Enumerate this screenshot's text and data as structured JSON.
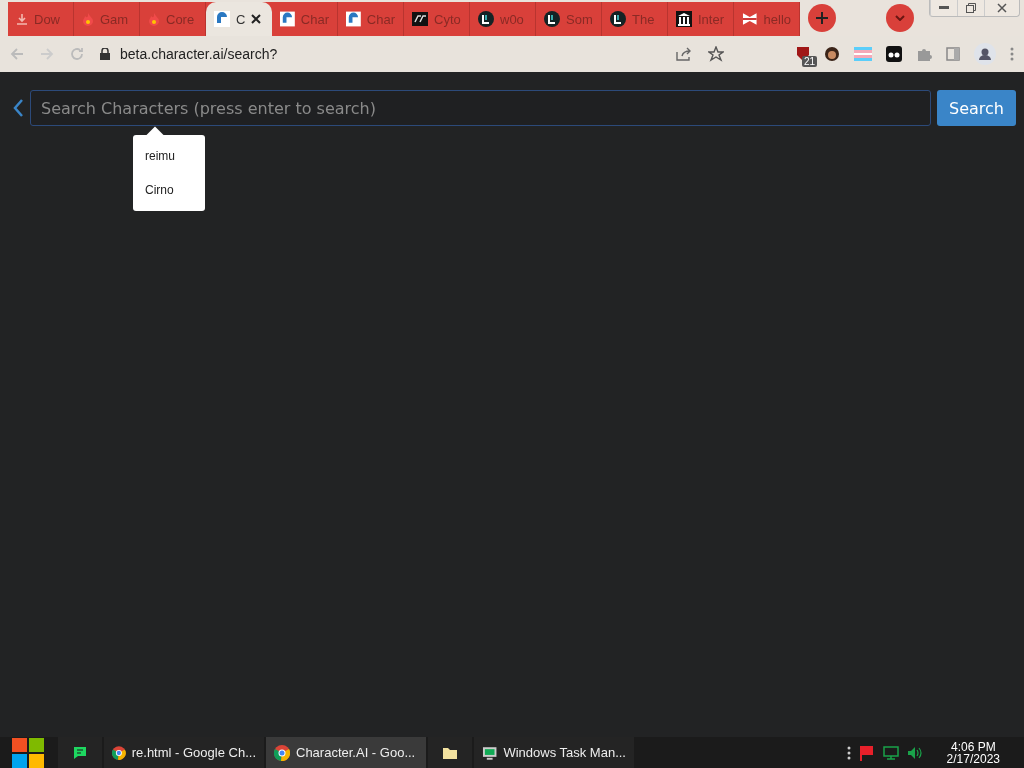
{
  "tabs": [
    {
      "label": "Dow",
      "kind": "download",
      "selected": false
    },
    {
      "label": "Gam",
      "kind": "flame",
      "selected": false
    },
    {
      "label": "Core",
      "kind": "flame",
      "selected": false
    },
    {
      "label": "C",
      "kind": "character",
      "selected": true
    },
    {
      "label": "Char",
      "kind": "character",
      "selected": false
    },
    {
      "label": "Char",
      "kind": "character",
      "selected": false
    },
    {
      "label": "Cyto",
      "kind": "square",
      "selected": false
    },
    {
      "label": "w0o",
      "kind": "circle",
      "selected": false
    },
    {
      "label": "Som",
      "kind": "circle",
      "selected": false
    },
    {
      "label": "The",
      "kind": "circle",
      "selected": false
    },
    {
      "label": "Inter",
      "kind": "building",
      "selected": false
    },
    {
      "label": "hello",
      "kind": "bookmark",
      "selected": false
    }
  ],
  "address_bar": {
    "url": "beta.character.ai/search?",
    "extension_badge": "21"
  },
  "search": {
    "placeholder": "Search Characters (press enter to search)",
    "button": "Search"
  },
  "suggestions": [
    "reimu",
    "Cirno"
  ],
  "taskbar": {
    "items": [
      {
        "label": "re.html - Google Ch...",
        "kind": "chrome",
        "selected": false
      },
      {
        "label": "Character.AI - Goo...",
        "kind": "chrome",
        "selected": true
      },
      {
        "label": "Windows Task Man...",
        "kind": "monitor",
        "selected": false
      }
    ],
    "time": "4:06 PM",
    "date": "2/17/2023"
  }
}
